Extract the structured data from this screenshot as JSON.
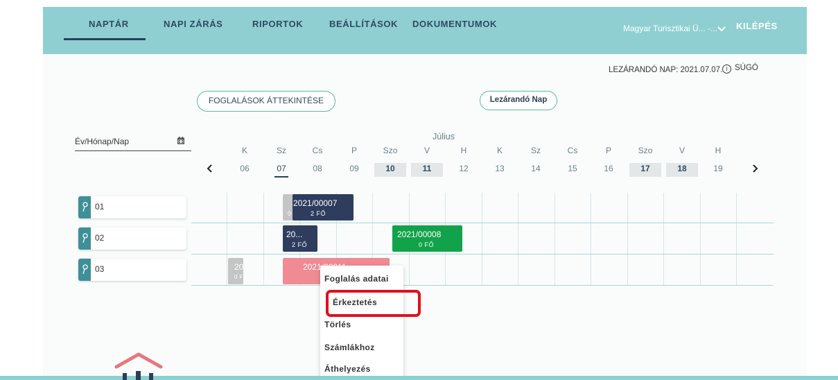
{
  "nav": {
    "items": [
      "NAPTÁR",
      "NAPI ZÁRÁS",
      "RIPORTOK",
      "BEÁLLÍTÁSOK",
      "DOKUMENTUMOK"
    ],
    "org": "Magyar Turisztikai Ü... -...",
    "logout": "KILÉPÉS"
  },
  "info": {
    "closing_day": "LEZÁRANDÓ NAP: 2021.07.07.",
    "help": "SÚGÓ"
  },
  "buttons": {
    "overview": "FOGLALÁSOK ÁTTEKINTÉSE",
    "closing": "Lezárandó Nap"
  },
  "date_field": {
    "placeholder": "Év/Hónap/Nap"
  },
  "calendar": {
    "month": "Július",
    "days": [
      {
        "dow": "K",
        "num": "06"
      },
      {
        "dow": "Sz",
        "num": "07"
      },
      {
        "dow": "Cs",
        "num": "08"
      },
      {
        "dow": "P",
        "num": "09"
      },
      {
        "dow": "Szo",
        "num": "10"
      },
      {
        "dow": "V",
        "num": "11"
      },
      {
        "dow": "H",
        "num": "12"
      },
      {
        "dow": "K",
        "num": "13"
      },
      {
        "dow": "Sz",
        "num": "14"
      },
      {
        "dow": "Cs",
        "num": "15"
      },
      {
        "dow": "P",
        "num": "16"
      },
      {
        "dow": "Szo",
        "num": "17"
      },
      {
        "dow": "V",
        "num": "18"
      },
      {
        "dow": "H",
        "num": "19"
      }
    ]
  },
  "rooms": [
    "01",
    "02",
    "03"
  ],
  "bookings": {
    "b1": {
      "id": "2021/00007",
      "guests": "2 FŐ",
      "color": "#2e3c5e"
    },
    "b2": {
      "id": "20...",
      "guests": "2 FŐ",
      "color": "#2e3c5e"
    },
    "b3": {
      "id": "2021/00008",
      "guests": "0 FŐ",
      "color": "#12a24a"
    },
    "b4": {
      "id": "2021/00011",
      "guests": "",
      "color": "#f08a93"
    },
    "b5": {
      "id": "20",
      "guests": "0 F",
      "color": "#c5c5c5"
    },
    "b6": {
      "guests": "0",
      "color": "#c5c5c5"
    }
  },
  "context_menu": [
    "Foglalás adatai",
    "Érkeztetés",
    "Törlés",
    "Számlákhoz",
    "Áthelyezés"
  ],
  "colors": {
    "header": "#8fcfd1",
    "navy": "#2b3e59",
    "highlight": "#e0101a",
    "outline_button": "#55b99e"
  }
}
